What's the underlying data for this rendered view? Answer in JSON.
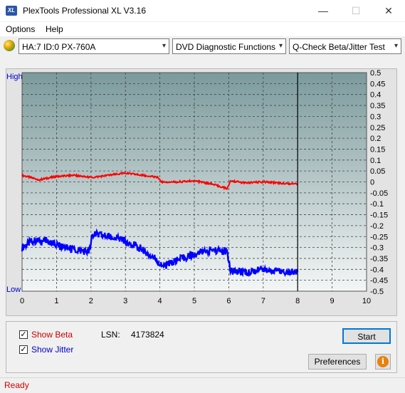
{
  "window": {
    "title": "PlexTools Professional XL V3.16",
    "icon_text": "XL",
    "minimize": "—",
    "maximize": "☐",
    "close": "✕"
  },
  "menu": {
    "items": [
      {
        "label": "Options"
      },
      {
        "label": "Help"
      }
    ]
  },
  "toolbar": {
    "drive": "HA:7 ID:0  PX-760A",
    "function": "DVD Diagnostic Functions",
    "test": "Q-Check Beta/Jitter Test"
  },
  "chart_data": {
    "type": "line",
    "left_axis_labels": {
      "top": "High",
      "bottom": "Low"
    },
    "x_ticks": [
      "0",
      "1",
      "2",
      "3",
      "4",
      "5",
      "6",
      "7",
      "8",
      "9",
      "10"
    ],
    "y_right_ticks": [
      "0.5",
      "0.45",
      "0.4",
      "0.35",
      "0.3",
      "0.25",
      "0.2",
      "0.15",
      "0.1",
      "0.05",
      "0",
      "-0.05",
      "-0.1",
      "-0.15",
      "-0.2",
      "-0.25",
      "-0.3",
      "-0.35",
      "-0.4",
      "-0.45",
      "-0.5"
    ],
    "xlim": [
      0,
      10
    ],
    "ylim": [
      -0.5,
      0.5
    ],
    "grid": true,
    "end_marker_x": 8,
    "series": [
      {
        "color": "#ff0000",
        "x": [
          0,
          0.5,
          1,
          1.5,
          2,
          2.5,
          3,
          3.5,
          3.95,
          4.05,
          4.5,
          5,
          5.5,
          5.95,
          6.05,
          6.5,
          7,
          7.5,
          8
        ],
        "values": [
          0.03,
          0.01,
          0.025,
          0.03,
          0.02,
          0.03,
          0.04,
          0.03,
          0.02,
          0.0,
          0.0,
          0.005,
          -0.01,
          -0.03,
          0.005,
          -0.005,
          0.0,
          -0.005,
          -0.01
        ]
      },
      {
        "color": "#0000ff",
        "x": [
          0,
          0.3,
          0.7,
          1,
          1.5,
          1.95,
          2.05,
          2.5,
          3,
          3.5,
          3.95,
          4.05,
          4.5,
          5,
          5.5,
          5.95,
          6.05,
          6.5,
          7,
          7.5,
          8
        ],
        "values": [
          -0.3,
          -0.27,
          -0.27,
          -0.29,
          -0.31,
          -0.32,
          -0.24,
          -0.25,
          -0.27,
          -0.31,
          -0.36,
          -0.39,
          -0.36,
          -0.33,
          -0.31,
          -0.32,
          -0.41,
          -0.41,
          -0.4,
          -0.41,
          -0.41
        ]
      }
    ]
  },
  "options": {
    "show_beta": {
      "checked": true,
      "label": "Show Beta",
      "color": "#c80000"
    },
    "show_jitter": {
      "checked": true,
      "label": "Show Jitter",
      "color": "#0000c8"
    },
    "lsn_label": "LSN:",
    "lsn_value": "4173824",
    "check_mark": "✓"
  },
  "buttons": {
    "start": "Start",
    "preferences": "Preferences",
    "info_icon": "i"
  },
  "status": {
    "text": "Ready"
  }
}
